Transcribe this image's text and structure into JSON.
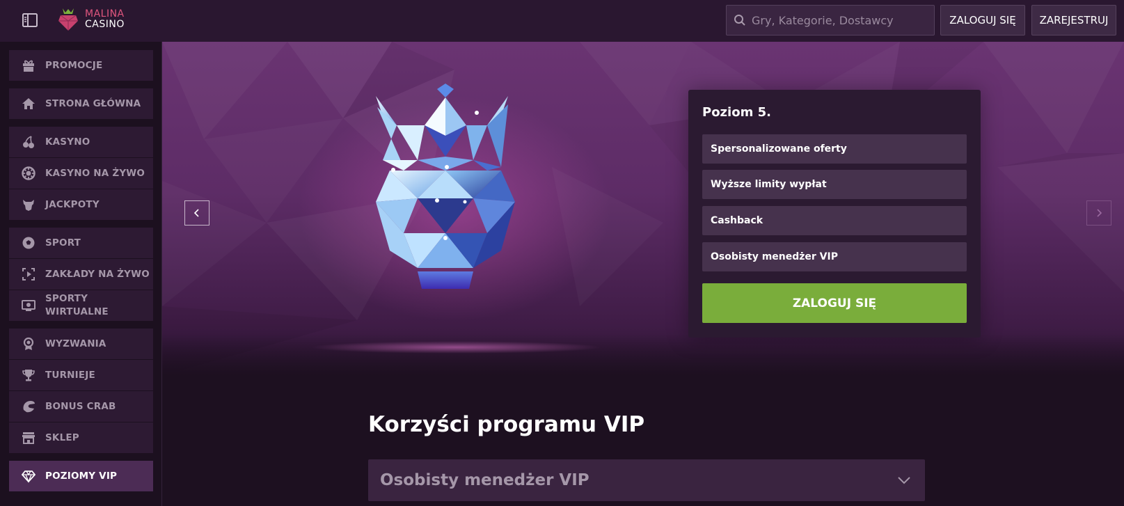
{
  "header": {
    "logo_line1": "MALINA",
    "logo_line2": "CASINO",
    "search_placeholder": "Gry, Kategorie, Dostawcy",
    "login_label": "ZALOGUJ SIĘ",
    "register_label": "ZAREJESTRUJ"
  },
  "sidebar": {
    "items": [
      {
        "label": "PROMOCJE",
        "icon": "gift-icon"
      },
      {
        "label": "STRONA GŁÓWNA",
        "icon": "home-icon"
      },
      {
        "label": "KASYNO",
        "icon": "cherries-icon"
      },
      {
        "label": "KASYNO NA ŻYWO",
        "icon": "chip-icon"
      },
      {
        "label": "JACKPOTY",
        "icon": "bull-icon"
      },
      {
        "label": "SPORT",
        "icon": "soccer-ball-icon"
      },
      {
        "label": "ZAKŁADY NA ŻYWO",
        "icon": "live-play-icon"
      },
      {
        "label": "SPORTY WIRTUALNE",
        "icon": "virtual-screen-icon"
      },
      {
        "label": "WYZWANIA",
        "icon": "award-icon"
      },
      {
        "label": "TURNIEJE",
        "icon": "trophy-icon"
      },
      {
        "label": "BONUS CRAB",
        "icon": "claw-icon"
      },
      {
        "label": "SKLEP",
        "icon": "shop-icon"
      },
      {
        "label": "POZIOMY VIP",
        "icon": "diamond-icon"
      }
    ],
    "active": "POZIOMY VIP"
  },
  "level_card": {
    "title": "Poziom 5.",
    "benefits": [
      "Spersonalizowane oferty",
      "Wyższe limity wypłat",
      "Cashback",
      "Osobisty menedżer VIP"
    ],
    "button_label": "ZALOGUJ SIĘ"
  },
  "section": {
    "title": "Korzyści programu VIP",
    "accordion_label": "Osobisty menedżer VIP"
  },
  "colors": {
    "accent_green": "#7aad3b",
    "brand_pink": "#e0567e",
    "background": "#1d1020"
  }
}
